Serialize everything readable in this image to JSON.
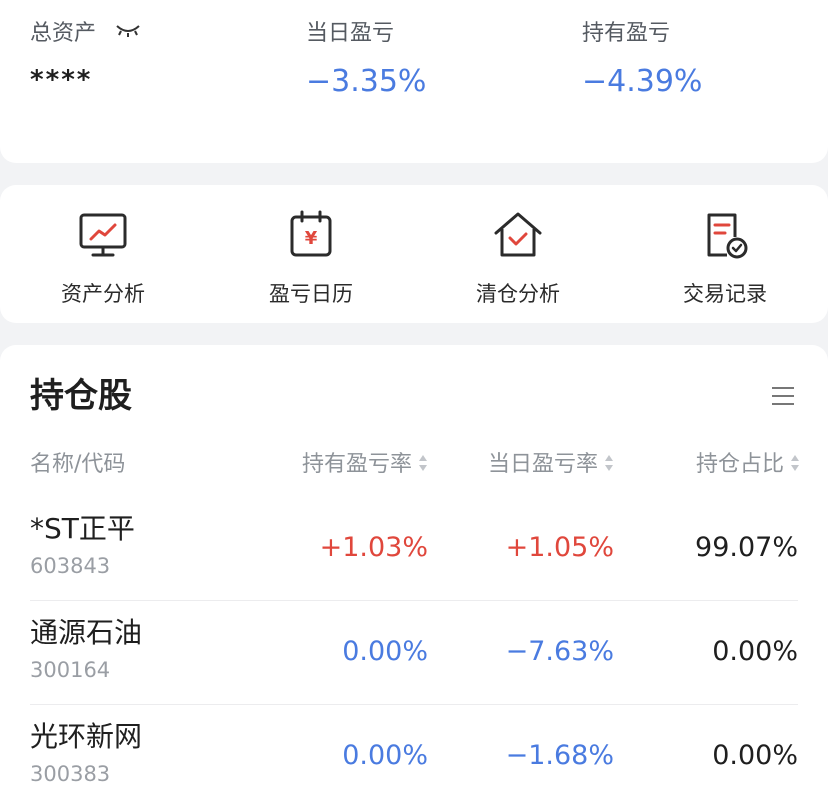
{
  "summary": {
    "total_assets_label": "总资产",
    "total_assets_value": "****",
    "daily_pnl_label": "当日盈亏",
    "daily_pnl_value": "−3.35%",
    "holding_pnl_label": "持有盈亏",
    "holding_pnl_value": "−4.39%"
  },
  "actions": [
    {
      "label": "资产分析",
      "icon": "monitor-chart-icon"
    },
    {
      "label": "盈亏日历",
      "icon": "calendar-yen-icon"
    },
    {
      "label": "清仓分析",
      "icon": "house-check-icon"
    },
    {
      "label": "交易记录",
      "icon": "document-check-icon"
    }
  ],
  "holdings": {
    "title": "持仓股",
    "columns": [
      "名称/代码",
      "持有盈亏率",
      "当日盈亏率",
      "持仓占比"
    ],
    "rows": [
      {
        "name": "*ST正平",
        "code": "603843",
        "holding_rate": "+1.03%",
        "daily_rate": "+1.05%",
        "ratio": "99.07%"
      },
      {
        "name": "通源石油",
        "code": "300164",
        "holding_rate": "0.00%",
        "daily_rate": "−7.63%",
        "ratio": "0.00%"
      },
      {
        "name": "光环新网",
        "code": "300383",
        "holding_rate": "0.00%",
        "daily_rate": "−1.68%",
        "ratio": "0.00%"
      }
    ]
  },
  "colors": {
    "up": "#e0473c",
    "down": "#4a7be0",
    "accent_icon": "#e0473c",
    "background": "#f2f3f5"
  }
}
